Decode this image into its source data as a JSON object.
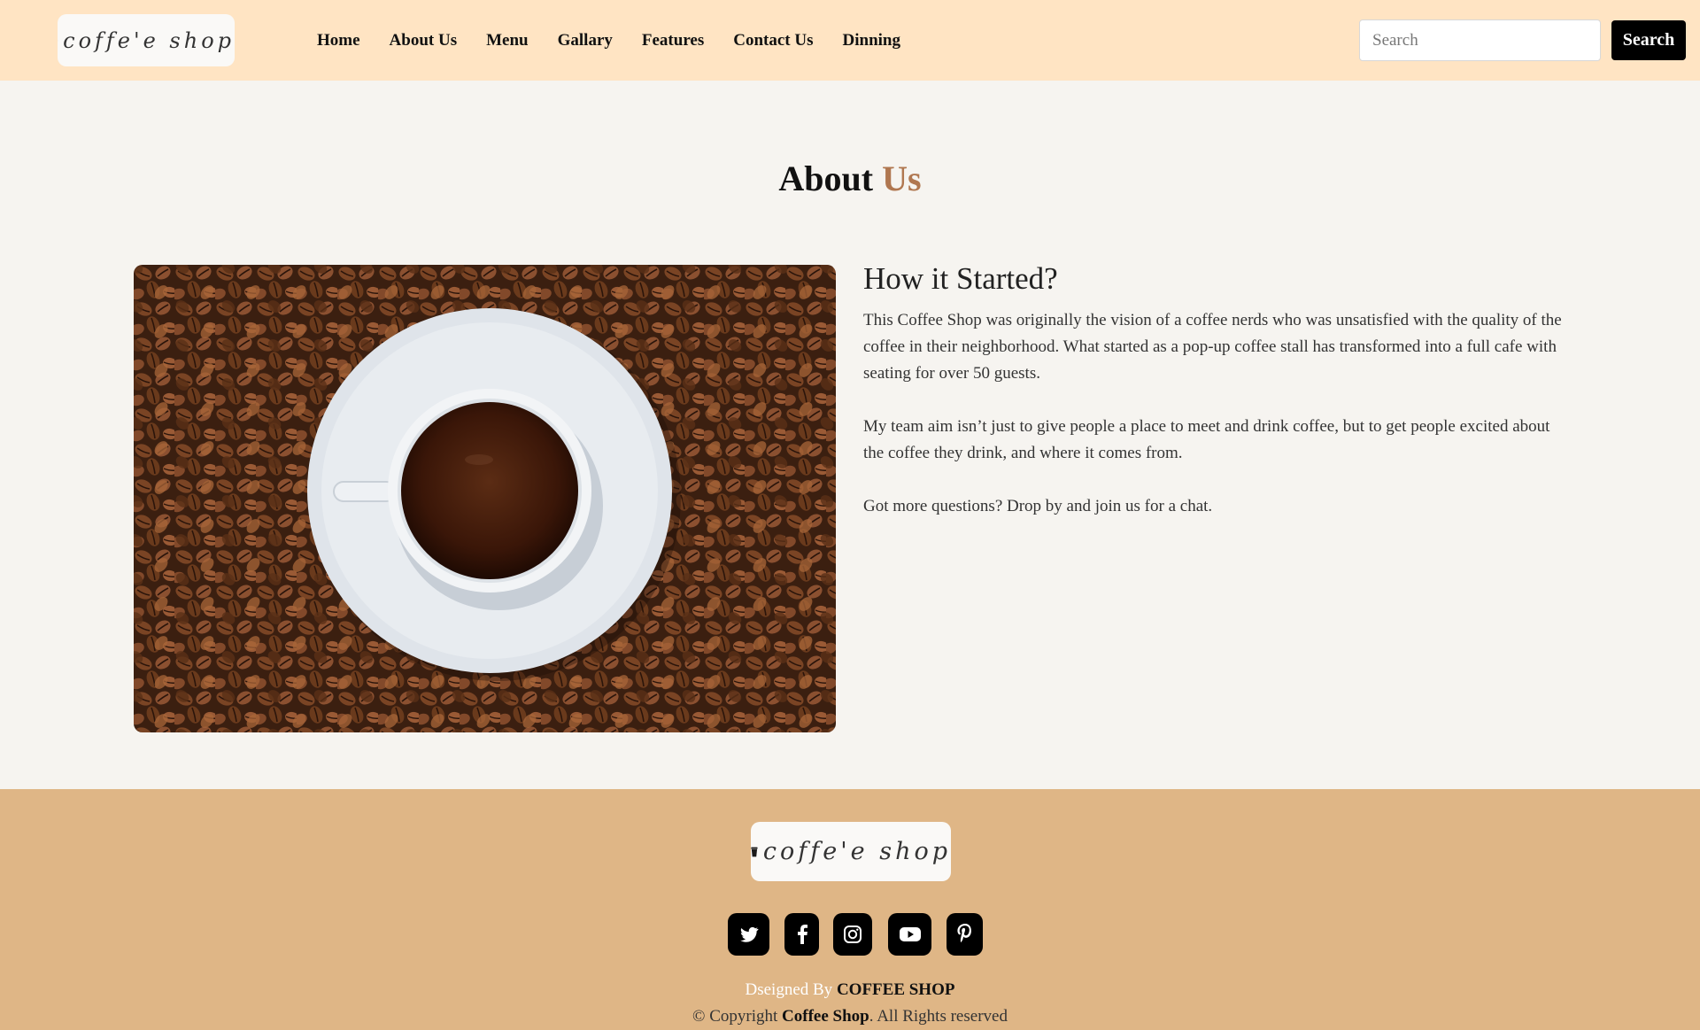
{
  "header": {
    "logo_text": "coffe'e shop",
    "nav": [
      "Home",
      "About Us",
      "Menu",
      "Gallary",
      "Features",
      "Contact Us",
      "Dinning"
    ],
    "search_placeholder": "Search",
    "search_button": "Search"
  },
  "about": {
    "title_main": "About",
    "title_accent": "Us",
    "heading": "How it Started?",
    "paragraphs": [
      "This Coffee Shop was originally the vision of a coffee nerds who was unsatisfied with the quality of the coffee in their neighborhood. What started as a pop-up coffee stall has transformed into a full cafe with seating for over 50 guests.",
      "My team aim isn’t just to give people a place to meet and drink coffee, but to get people excited about the coffee they drink, and where it comes from.",
      "Got more questions? Drop by and join us for a chat."
    ]
  },
  "footer": {
    "logo_text": "coffe'e shop",
    "social": [
      "twitter-icon",
      "facebook-icon",
      "instagram-icon",
      "youtube-icon",
      "pinterest-icon"
    ],
    "credit_prefix": "Dseigned By ",
    "credit_name": "COFFEE SHOP",
    "copyright_prefix": "© Copyright ",
    "copyright_name": "Coffee Shop",
    "copyright_suffix": ". All Rights reserved"
  },
  "colors": {
    "header_bg": "#ffe4c3",
    "page_bg": "#f6f4f0",
    "footer_bg": "#dfb686",
    "accent": "#b07750",
    "button": "#000000"
  }
}
